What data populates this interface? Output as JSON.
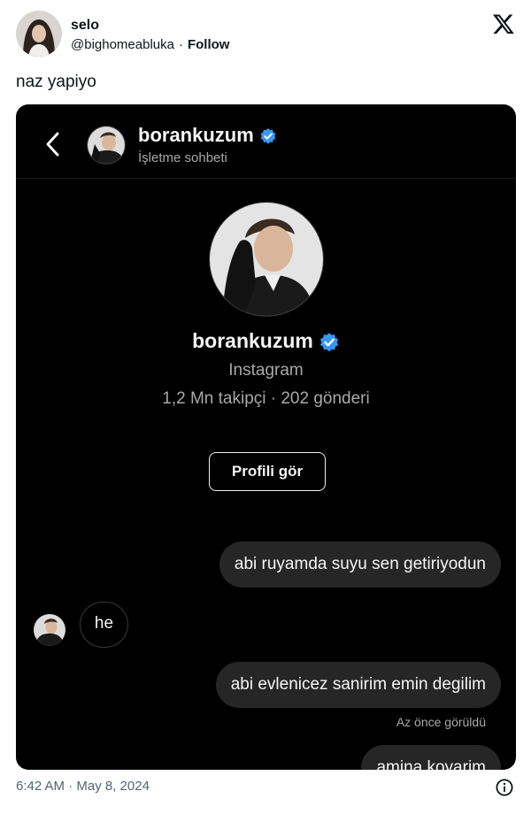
{
  "tweet": {
    "author_name": "selo",
    "author_handle": "@bighomeabluka",
    "separator": "·",
    "follow_label": "Follow",
    "text": "naz yapiyo",
    "timestamp": "6:42 AM · May 8, 2024"
  },
  "dm": {
    "header_name": "borankuzum",
    "header_subtitle": "İşletme sohbeti",
    "profile_name": "borankuzum",
    "profile_platform": "Instagram",
    "profile_stats": "1,2 Mn takipçi · 202 gönderi",
    "view_profile_label": "Profili gör",
    "messages": [
      {
        "direction": "outgoing",
        "text": "abi ruyamda suyu sen getiriyodun"
      },
      {
        "direction": "incoming",
        "text": "he"
      },
      {
        "direction": "outgoing",
        "text": "abi evlenicez sanirim emin degilim"
      },
      {
        "direction": "outgoing",
        "text": "amina koyarim"
      }
    ],
    "seen_label": "Az önce görüldü"
  },
  "colors": {
    "verified_blue": "#3897f0",
    "dm_background": "#000000",
    "bubble_outgoing": "#262626"
  },
  "icons": [
    "x-logo-icon",
    "back-chevron-icon",
    "verified-badge-icon",
    "info-icon"
  ]
}
